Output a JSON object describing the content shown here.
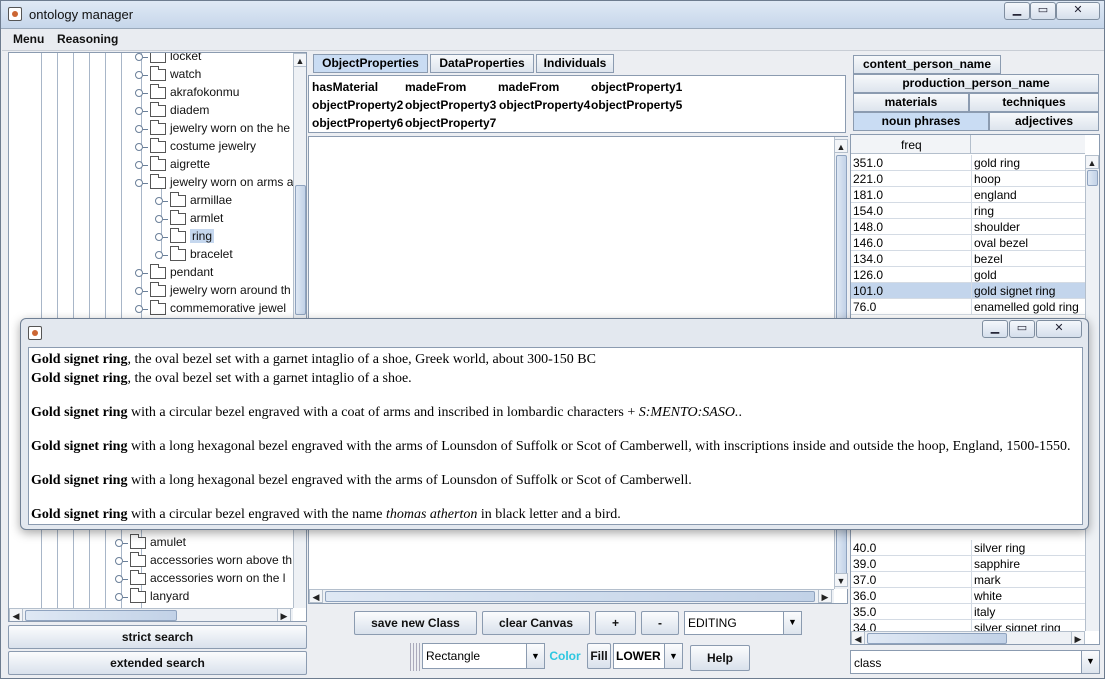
{
  "window": {
    "title": "ontology manager"
  },
  "menu": [
    "Menu",
    "Reasoning"
  ],
  "tree": {
    "items": [
      {
        "label": "locket",
        "level": 1
      },
      {
        "label": "watch",
        "level": 1
      },
      {
        "label": "akrafokonmu",
        "level": 1
      },
      {
        "label": "diadem",
        "level": 1
      },
      {
        "label": "jewelry worn on the he",
        "level": 1
      },
      {
        "label": "costume jewelry",
        "level": 1
      },
      {
        "label": "aigrette",
        "level": 1
      },
      {
        "label": "jewelry worn on arms a",
        "level": 1
      },
      {
        "label": "armillae",
        "level": 2
      },
      {
        "label": "armlet",
        "level": 2
      },
      {
        "label": "ring",
        "level": 2,
        "selected": true
      },
      {
        "label": "bracelet",
        "level": 2
      },
      {
        "label": "pendant",
        "level": 1
      },
      {
        "label": "jewelry worn around th",
        "level": 1
      },
      {
        "label": "commemorative jewel",
        "level": 1
      }
    ],
    "bottom_items": [
      {
        "label": "amulet"
      },
      {
        "label": "accessories worn above th"
      },
      {
        "label": "accessories worn on the l"
      },
      {
        "label": "lanyard"
      }
    ]
  },
  "left_buttons": {
    "strict": "strict search",
    "extended": "extended search"
  },
  "center_tabs": [
    "ObjectProperties",
    "DataProperties",
    "Individuals"
  ],
  "properties": [
    [
      "hasMaterial",
      "madeFrom",
      "madeFrom",
      "objectProperty1"
    ],
    [
      "objectProperty2",
      "objectProperty3",
      "objectProperty4",
      "objectProperty5"
    ],
    [
      "objectProperty6",
      "objectProperty7"
    ]
  ],
  "toolbar": {
    "save": "save new Class",
    "clear": "clear Canvas",
    "plus": "+",
    "minus": "-",
    "mode": "EDITING",
    "shape": "Rectangle",
    "color": "Color",
    "fill": "Fill",
    "case": "LOWER",
    "help": "Help"
  },
  "right_tabs": {
    "row1": [
      "content_person_name"
    ],
    "row2": [
      "production_person_name"
    ],
    "row3": [
      "materials",
      "techniques"
    ],
    "row4": [
      "noun phrases",
      "adjectives"
    ]
  },
  "table": {
    "header": "freq",
    "rows": [
      {
        "freq": "351.0",
        "term": "gold ring"
      },
      {
        "freq": "221.0",
        "term": "hoop"
      },
      {
        "freq": "181.0",
        "term": "england"
      },
      {
        "freq": "154.0",
        "term": "ring"
      },
      {
        "freq": "148.0",
        "term": "shoulder"
      },
      {
        "freq": "146.0",
        "term": "oval bezel"
      },
      {
        "freq": "134.0",
        "term": "bezel"
      },
      {
        "freq": "126.0",
        "term": "gold"
      },
      {
        "freq": "101.0",
        "term": "gold signet ring",
        "selected": true
      },
      {
        "freq": "76.0",
        "term": "enamelled gold ring"
      }
    ],
    "bottom_rows": [
      {
        "freq": "40.0",
        "term": "silver ring"
      },
      {
        "freq": "39.0",
        "term": "sapphire"
      },
      {
        "freq": "37.0",
        "term": "mark"
      },
      {
        "freq": "36.0",
        "term": "white"
      },
      {
        "freq": "35.0",
        "term": "italy"
      },
      {
        "freq": "34.0",
        "term": "silver signet ring"
      }
    ]
  },
  "class_combo": "class",
  "dialog": {
    "lines": [
      {
        "bold": "Gold signet ring",
        "rest": ", the oval bezel set with a garnet intaglio of a shoe, Greek world, about 300-150 BC"
      },
      {
        "bold": "Gold signet ring",
        "rest": ", the oval bezel set with a garnet intaglio of a shoe."
      },
      {
        "bold": "Gold signet ring",
        "rest": " with a circular bezel engraved with a coat of arms and inscribed in lombardic characters + ",
        "italic": "S:MENTO:SASO.",
        "tail": "."
      },
      {
        "bold": "Gold signet ring",
        "rest": " with a long hexagonal bezel engraved with the arms of Lounsdon of Suffolk or Scot of Camberwell, with inscriptions inside and outside the hoop, England, 1500-1550."
      },
      {
        "bold": "Gold signet ring",
        "rest": " with a long hexagonal bezel engraved with the arms of Lounsdon of Suffolk or Scot of Camberwell."
      },
      {
        "bold": "Gold signet ring",
        "rest": " with a circular bezel engraved with the name ",
        "italic": "thomas atherton",
        "tail": " in black letter and a bird."
      }
    ]
  }
}
